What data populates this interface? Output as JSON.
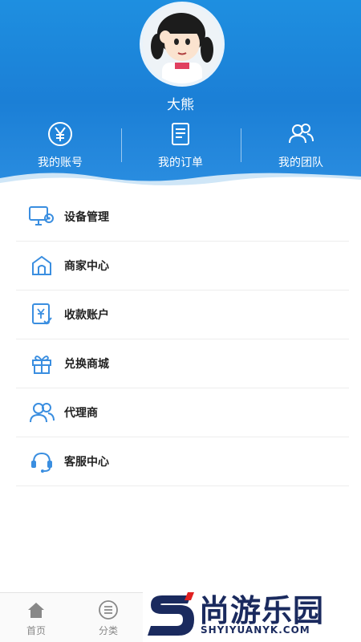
{
  "profile": {
    "username": "大熊"
  },
  "stats": [
    {
      "label": "我的账号",
      "icon": "yen-circle-icon"
    },
    {
      "label": "我的订单",
      "icon": "order-document-icon"
    },
    {
      "label": "我的团队",
      "icon": "team-users-icon"
    }
  ],
  "menu": [
    {
      "label": "设备管理",
      "icon": "device-settings-icon"
    },
    {
      "label": "商家中心",
      "icon": "store-icon"
    },
    {
      "label": "收款账户",
      "icon": "payment-account-icon"
    },
    {
      "label": "兑换商城",
      "icon": "gift-icon"
    },
    {
      "label": "代理商",
      "icon": "agent-users-icon"
    },
    {
      "label": "客服中心",
      "icon": "headset-icon"
    }
  ],
  "bottom_nav": [
    {
      "label": "首页",
      "icon": "home-icon"
    },
    {
      "label": "分类",
      "icon": "category-list-icon"
    }
  ],
  "watermark": {
    "main": "尚游乐园",
    "sub": "SHYIYUANYK.COM"
  },
  "colors": {
    "header_blue": "#1b7fd6",
    "icon_blue": "#3a8ee0",
    "watermark_navy": "#1a2a5e",
    "watermark_red": "#e02020"
  }
}
